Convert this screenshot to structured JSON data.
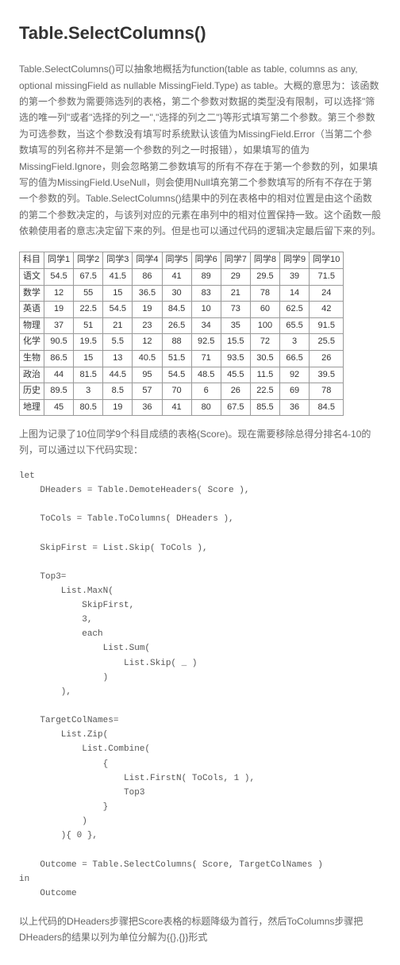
{
  "title": "Table.SelectColumns()",
  "intro_html": "Table.SelectColumns()可以抽象地概括为function(table as table, columns as any, optional missingField as nullable MissingField.Type) as table。大概的意思为：该函数的第一个参数为需要筛选列的表格，第二个参数对数据的类型没有限制，可以选择\"筛选的唯一列\"或者\"选择的列之一\",\"选择的列之二\"}等形式填写第二个参数。第三个参数为可选参数，当这个参数没有填写时系统默认该值为MissingField.Error（当第二个参数填写的列名称并不是第一个参数的列之一时报错），如果填写的值为MissingField.Ignore，则会忽略第二参数填写的所有不存在于第一个参数的列，如果填写的值为MissingField.UseNull，则会使用Null填充第二个参数填写的所有不存在于第一个参数的列。Table.SelectColumns()结果中的列在表格中的相对位置是由这个函数的第二个参数决定的，与该列对应的元素在串列中的相对位置保持一致。这个函数一般依赖使用者的意志决定留下来的列。但是也可以通过代码的逻辑决定最后留下来的列。",
  "table": {
    "headers": [
      "科目",
      "同学1",
      "同学2",
      "同学3",
      "同学4",
      "同学5",
      "同学6",
      "同学7",
      "同学8",
      "同学9",
      "同学10"
    ],
    "rows": [
      [
        "语文",
        "54.5",
        "67.5",
        "41.5",
        "86",
        "41",
        "89",
        "29",
        "29.5",
        "39",
        "71.5"
      ],
      [
        "数学",
        "12",
        "55",
        "15",
        "36.5",
        "30",
        "83",
        "21",
        "78",
        "14",
        "24"
      ],
      [
        "英语",
        "19",
        "22.5",
        "54.5",
        "19",
        "84.5",
        "10",
        "73",
        "60",
        "62.5",
        "42"
      ],
      [
        "物理",
        "37",
        "51",
        "21",
        "23",
        "26.5",
        "34",
        "35",
        "100",
        "65.5",
        "91.5"
      ],
      [
        "化学",
        "90.5",
        "19.5",
        "5.5",
        "12",
        "88",
        "92.5",
        "15.5",
        "72",
        "3",
        "25.5"
      ],
      [
        "生物",
        "86.5",
        "15",
        "13",
        "40.5",
        "51.5",
        "71",
        "93.5",
        "30.5",
        "66.5",
        "26"
      ],
      [
        "政治",
        "44",
        "81.5",
        "44.5",
        "95",
        "54.5",
        "48.5",
        "45.5",
        "11.5",
        "92",
        "39.5"
      ],
      [
        "历史",
        "89.5",
        "3",
        "8.5",
        "57",
        "70",
        "6",
        "26",
        "22.5",
        "69",
        "78"
      ],
      [
        "地理",
        "45",
        "80.5",
        "19",
        "36",
        "41",
        "80",
        "67.5",
        "85.5",
        "36",
        "84.5"
      ]
    ]
  },
  "caption": "上图为记录了10位同学9个科目成绩的表格(Score)。现在需要移除总得分排名4-10的列，可以通过以下代码实现：",
  "code": "let\n    DHeaders = Table.DemoteHeaders( Score ),\n\n    ToCols = Table.ToColumns( DHeaders ),\n\n    SkipFirst = List.Skip( ToCols ),\n\n    Top3=\n        List.MaxN(\n            SkipFirst,\n            3,\n            each\n                List.Sum(\n                    List.Skip( _ )\n                )\n        ),\n\n    TargetColNames=\n        List.Zip(\n            List.Combine(\n                {\n                    List.FirstN( ToCols, 1 ),\n                    Top3\n                }\n            )\n        ){ 0 },\n\n    Outcome = Table.SelectColumns( Score, TargetColNames )\nin\n    Outcome",
  "footer": "以上代码的DHeaders步骤把Score表格的标题降级为首行，然后ToColumns步骤把DHeaders的结果以列为单位分解为{{},{}}形式"
}
